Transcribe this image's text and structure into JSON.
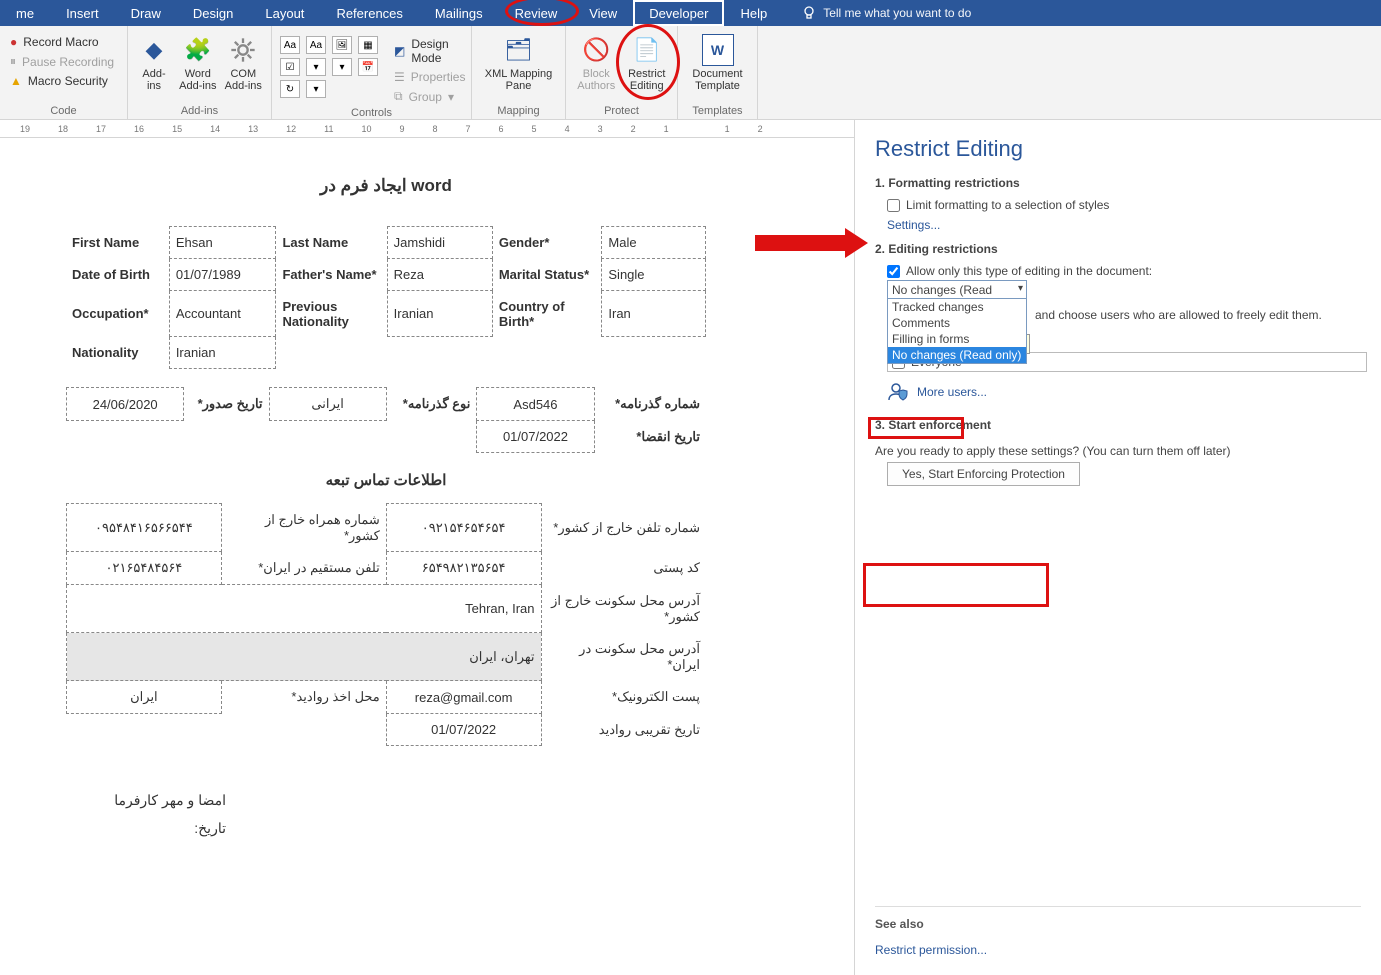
{
  "menu": {
    "items": [
      "me",
      "Insert",
      "Draw",
      "Design",
      "Layout",
      "References",
      "Mailings",
      "Review",
      "View",
      "Developer",
      "Help"
    ],
    "active": "Developer",
    "tell_placeholder": "Tell me what you want to do"
  },
  "ribbon": {
    "code": {
      "label": "Code",
      "record_macro": "Record Macro",
      "pause_recording": "Pause Recording",
      "macro_security": "Macro Security"
    },
    "addins": {
      "label": "Add-ins",
      "addins": "Add-ins",
      "word_addins": "Word Add-ins",
      "com_addins": "COM Add-ins"
    },
    "controls": {
      "label": "Controls",
      "design_mode": "Design Mode",
      "properties": "Properties",
      "group": "Group"
    },
    "mapping": {
      "label": "Mapping",
      "xml_mapping_pane": "XML Mapping Pane"
    },
    "protect": {
      "label": "Protect",
      "block_authors": "Block Authors",
      "restrict_editing": "Restrict Editing"
    },
    "templates": {
      "label": "Templates",
      "document_template": "Document Template"
    }
  },
  "ruler": {
    "marks": [
      "19",
      "18",
      "17",
      "16",
      "15",
      "14",
      "13",
      "12",
      "11",
      "10",
      "9",
      "8",
      "7",
      "6",
      "5",
      "4",
      "3",
      "2",
      "1",
      "",
      "1",
      "2"
    ]
  },
  "document": {
    "title": "ایجاد فرم در  word",
    "row1": [
      {
        "label": "First Name",
        "value": "Ehsan"
      },
      {
        "label": "Last Name",
        "value": "Jamshidi"
      },
      {
        "label": "Gender*",
        "value": "Male"
      }
    ],
    "row2": [
      {
        "label": "Date of Birth",
        "value": "01/07/1989"
      },
      {
        "label": "Father's Name*",
        "value": "Reza"
      },
      {
        "label": "Marital Status*",
        "value": "Single"
      }
    ],
    "row3": [
      {
        "label": "Occupation*",
        "value": "Accountant"
      },
      {
        "label": "Previous Nationality",
        "value": "Iranian"
      },
      {
        "label": "Country of Birth*",
        "value": "Iran"
      }
    ],
    "row4": [
      {
        "label": "Nationality",
        "value": "Iranian"
      }
    ],
    "passport": {
      "r1": [
        {
          "label": "شماره گذرنامه*",
          "value": "Asd546"
        },
        {
          "label": "نوع گذرنامه*",
          "value": "ایرانی"
        },
        {
          "label": "تاریخ صدور*",
          "value": "24/06/2020"
        }
      ],
      "r2": {
        "label": "تاریخ انقضا*",
        "value": "01/07/2022"
      }
    },
    "contact_section_title": "اطلاعات تماس تبعه",
    "contact": [
      {
        "label": "شماره تلفن خارج از کشور*",
        "value": "۰۹۲۱۵۴۶۵۴۶۵۴",
        "label2": "شماره همراه خارج از کشور*",
        "value2": "۰۹۵۴۸۴۱۶۵۶۶۵۴۴"
      },
      {
        "label": "کد پستی",
        "value": "۶۵۴۹۸۲۱۳۵۶۵۴",
        "label2": "تلفن مستقیم در ایران*",
        "value2": "۰۲۱۶۵۴۸۴۵۶۴"
      },
      {
        "label": "آدرس محل سکونت خارج از کشور*",
        "value": "Tehran, Iran",
        "colspan": 3
      },
      {
        "label": "آدرس محل سکونت در ایران*",
        "value": "تهران، ایران",
        "gray": true,
        "colspan": 3
      },
      {
        "label": "پست الکترونیک*",
        "value": "reza@gmail.com",
        "label2": "محل اخذ روادید*",
        "value2": "ایران"
      },
      {
        "label": "تاریخ تقریبی روادید",
        "value": "01/07/2022"
      }
    ],
    "signature": {
      "line1": "امضا و مهر کارفرما",
      "line2": "تاریخ:"
    }
  },
  "pane": {
    "title": "Restrict Editing",
    "sec1": {
      "heading": "1. Formatting restrictions",
      "checkbox": "Limit formatting to a selection of styles",
      "settings": "Settings..."
    },
    "sec2": {
      "heading": "2. Editing restrictions",
      "checkbox": "Allow only this type of editing in the document:",
      "selected": "No changes (Read only)",
      "options": [
        "Tracked changes",
        "Comments",
        "Filling in forms",
        "No changes (Read only)"
      ],
      "exceptions_note": "and choose users who are allowed to freely edit them.",
      "tooltip": "No changes (Read only)",
      "everyone": "Everyone",
      "more_users": "More users..."
    },
    "sec3": {
      "heading": "3. Start enforcement",
      "note": "Are you ready to apply these settings? (You can turn them off later)",
      "button": "Yes, Start Enforcing Protection"
    },
    "seealso": {
      "heading": "See also",
      "link": "Restrict permission..."
    }
  }
}
